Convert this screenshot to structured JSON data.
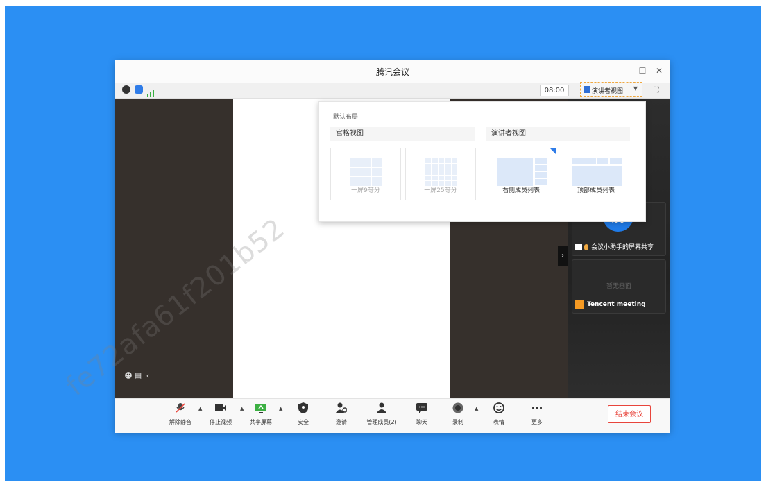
{
  "window": {
    "title": "腾讯会议"
  },
  "status": {
    "timer": "08:00",
    "layout_button_label": "演讲者视图"
  },
  "layout_popup": {
    "title": "默认布局",
    "section_grid": "宫格视图",
    "section_presenter": "演讲者视图",
    "options": [
      "一屏9等分",
      "一屏25等分",
      "右侧成员列表",
      "顶部成员列表"
    ]
  },
  "participants": {
    "assistant_avatar": "助手",
    "assistant_label": "会议小助手的屏幕共享",
    "member_video_text": "暂无画面",
    "member_name": "Tencent meeting"
  },
  "toolbar": {
    "unmute": "解除静音",
    "stop_video": "停止视频",
    "share_screen": "共享屏幕",
    "security": "安全",
    "invite": "邀请",
    "manage_members": "管理成员(2)",
    "chat": "聊天",
    "record": "录制",
    "reactions": "表情",
    "more": "更多",
    "end_meeting": "结束会议"
  },
  "watermark": "fe72afa61f201b52",
  "colors": {
    "brand_blue": "#2b8ff3",
    "end_red": "#e8453c",
    "accent_orange": "#f0a840"
  }
}
